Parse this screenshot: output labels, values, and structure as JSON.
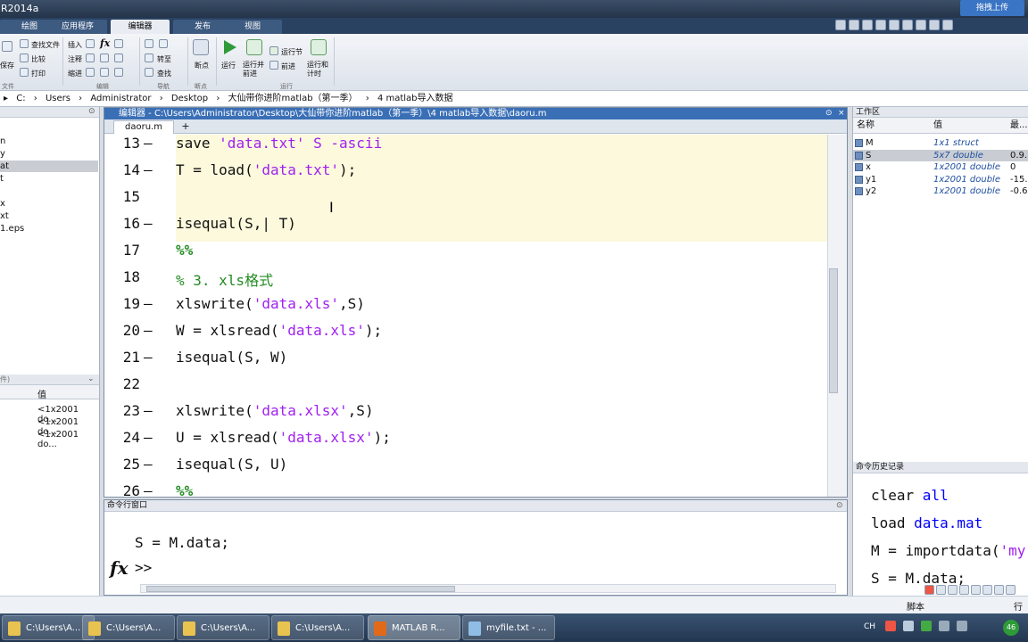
{
  "app": {
    "title": "R2014a"
  },
  "tabs": [
    {
      "label": "绘图"
    },
    {
      "label": "应用程序"
    },
    {
      "label": "编辑器"
    },
    {
      "label": "发布"
    },
    {
      "label": "视图"
    }
  ],
  "cloud_button": "拖拽上传",
  "ribbon": {
    "find_files": "查找文件",
    "compare": "比较",
    "print": "打印",
    "save": "保存",
    "insert": "插入",
    "comment": "注释",
    "indent": "缩进",
    "goto": "转至",
    "find": "查找",
    "breakpoint": "断点",
    "run": "运行",
    "run_advance": "运行并前进",
    "run_section": "运行节",
    "advance": "前进",
    "run_time": "运行和计时",
    "group_file": "文件",
    "group_edit": "编辑",
    "group_nav": "导航",
    "group_bp": "断点",
    "group_run": "运行"
  },
  "address": [
    "C:",
    "Users",
    "Administrator",
    "Desktop",
    "大仙带你进阶matlab（第一季）",
    "4 matlab导入数据"
  ],
  "left_files": [
    {
      "name": "n",
      "selected": false
    },
    {
      "name": "y",
      "selected": false
    },
    {
      "name": "at",
      "selected": true
    },
    {
      "name": "t",
      "selected": false
    },
    {
      "name": "x",
      "selected": false
    },
    {
      "name": "xt",
      "selected": false
    },
    {
      "name": "1.eps",
      "selected": false
    }
  ],
  "left_workspace": {
    "header_hint": "件)",
    "value_col": "值",
    "values": [
      "<1x2001 do...",
      "<1x2001 do...",
      "<1x2001 do..."
    ]
  },
  "editor": {
    "title": "编辑器 - C:\\Users\\Administrator\\Desktop\\大仙带你进阶matlab（第一季）\\4 matlab导入数据\\daoru.m",
    "file_tab": "daoru.m",
    "plus": "+",
    "lines": [
      {
        "n": "13",
        "dash": "—",
        "parts": [
          {
            "t": "save ",
            "c": ""
          },
          {
            "t": "'data.txt'",
            "c": "s"
          },
          {
            "t": " S -ascii",
            "c": "s"
          }
        ]
      },
      {
        "n": "14",
        "dash": "—",
        "parts": [
          {
            "t": "T = load(",
            "c": ""
          },
          {
            "t": "'data.txt'",
            "c": "s"
          },
          {
            "t": ");",
            "c": ""
          }
        ]
      },
      {
        "n": "15",
        "dash": "",
        "parts": []
      },
      {
        "n": "16",
        "dash": "—",
        "parts": [
          {
            "t": "isequal(S,| T)",
            "c": ""
          }
        ]
      },
      {
        "n": "17",
        "dash": "",
        "parts": [
          {
            "t": "%%",
            "c": "cb"
          }
        ]
      },
      {
        "n": "18",
        "dash": "",
        "parts": [
          {
            "t": "% 3. xls格式",
            "c": "c"
          }
        ]
      },
      {
        "n": "19",
        "dash": "—",
        "parts": [
          {
            "t": "xlswrite(",
            "c": ""
          },
          {
            "t": "'data.xls'",
            "c": "s"
          },
          {
            "t": ",S)",
            "c": ""
          }
        ]
      },
      {
        "n": "20",
        "dash": "—",
        "parts": [
          {
            "t": "W = xlsread(",
            "c": ""
          },
          {
            "t": "'data.xls'",
            "c": "s"
          },
          {
            "t": ");",
            "c": ""
          }
        ]
      },
      {
        "n": "21",
        "dash": "—",
        "parts": [
          {
            "t": "isequal(S, W)",
            "c": ""
          }
        ]
      },
      {
        "n": "22",
        "dash": "",
        "parts": []
      },
      {
        "n": "23",
        "dash": "—",
        "parts": [
          {
            "t": "xlswrite(",
            "c": ""
          },
          {
            "t": "'data.xlsx'",
            "c": "s"
          },
          {
            "t": ",S)",
            "c": ""
          }
        ]
      },
      {
        "n": "24",
        "dash": "—",
        "parts": [
          {
            "t": "U = xlsread(",
            "c": ""
          },
          {
            "t": "'data.xlsx'",
            "c": "s"
          },
          {
            "t": ");",
            "c": ""
          }
        ]
      },
      {
        "n": "25",
        "dash": "—",
        "parts": [
          {
            "t": "isequal(S, U)",
            "c": ""
          }
        ]
      },
      {
        "n": "26",
        "dash": "—",
        "parts": [
          {
            "t": "%%",
            "c": "cb"
          }
        ]
      }
    ]
  },
  "command_window": {
    "title": "命令行窗口",
    "line": "S = M.data;",
    "fx": "fx",
    "prompt": ">>"
  },
  "workspace": {
    "title": "工作区",
    "col_name": "名称",
    "col_value": "值",
    "col_min": "最...",
    "vars": [
      {
        "name": "M",
        "value": "1x1 struct",
        "min": ""
      },
      {
        "name": "S",
        "value": "5x7 double",
        "min": "0.9..."
      },
      {
        "name": "x",
        "value": "1x2001 double",
        "min": "0"
      },
      {
        "name": "y1",
        "value": "1x2001 double",
        "min": "-15..."
      },
      {
        "name": "y2",
        "value": "1x2001 double",
        "min": "-0.6..."
      }
    ]
  },
  "history": {
    "title": "命令历史记录",
    "lines": [
      {
        "a": "clear ",
        "b": "all"
      },
      {
        "a": "load ",
        "b": "data.mat"
      },
      {
        "a": "M = importdata(",
        "b": "'my"
      },
      {
        "a": "S = M.data;",
        "b": ""
      }
    ]
  },
  "status": {
    "script": "脚本",
    "row": "行"
  },
  "taskbar": [
    {
      "label": "C:\\Users\\A..."
    },
    {
      "label": "C:\\Users\\A..."
    },
    {
      "label": "C:\\Users\\A..."
    },
    {
      "label": "C:\\Users\\A..."
    },
    {
      "label": "MATLAB R..."
    },
    {
      "label": "myfile.txt - ..."
    }
  ],
  "tray": {
    "lang": "CH",
    "badge": "46"
  }
}
